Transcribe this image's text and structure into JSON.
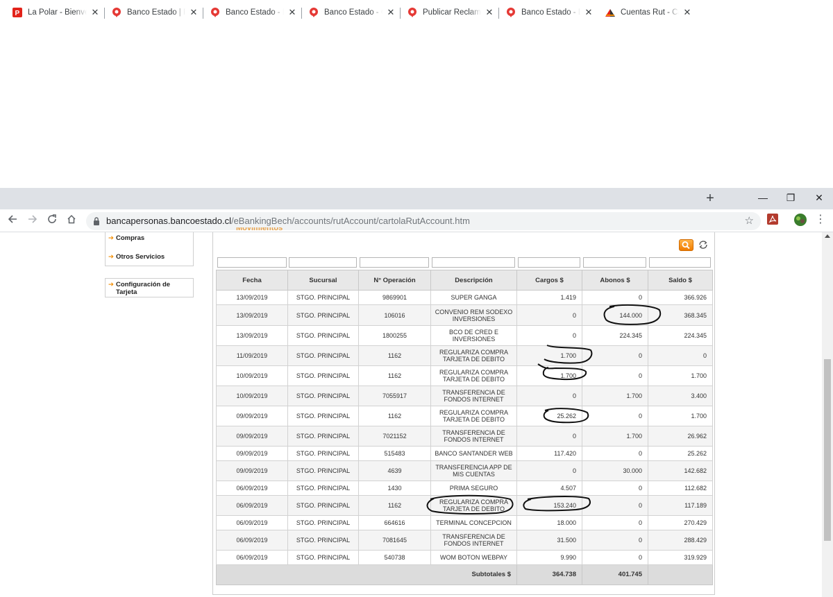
{
  "browser": {
    "tabs": [
      {
        "title": "La Polar - Bienvenido",
        "favicon": "la-polar-icon",
        "active": false
      },
      {
        "title": "Banco Estado | Reclamos",
        "favicon": "reclamos-icon",
        "active": false
      },
      {
        "title": "Banco Estado - Detalle",
        "favicon": "reclamos-icon",
        "active": false
      },
      {
        "title": "Banco Estado - Comentarios",
        "favicon": "reclamos-icon",
        "active": false
      },
      {
        "title": "Publicar Reclamo | Reclamos",
        "favicon": "reclamos-icon",
        "active": false
      },
      {
        "title": "Banco Estado - Duplicado",
        "favicon": "reclamos-icon",
        "active": false
      },
      {
        "title": "Cuentas Rut - Cartola",
        "favicon": "banco-estado-icon",
        "active": true
      }
    ],
    "new_tab": "+",
    "window_controls": {
      "minimize": "—",
      "restore": "❐",
      "close": "✕"
    },
    "url_domain": "bancapersonas.bancoestado.cl",
    "url_path": "/eBankingBech/accounts/rutAccount/cartolaRutAccount.htm",
    "colors": {
      "tabstrip": "#dee1e6",
      "accent_orange": "#f28c00"
    }
  },
  "sidebar": {
    "items": [
      {
        "label": "Compras"
      },
      {
        "label": "Otros Servicios"
      },
      {
        "label": "Configuración de Tarjeta"
      }
    ]
  },
  "section": {
    "title": "Movimientos"
  },
  "table": {
    "columns": [
      "Fecha",
      "Sucursal",
      "N° Operación",
      "Descripción",
      "Cargos $",
      "Abonos $",
      "Saldo $"
    ],
    "rows": [
      {
        "fecha": "13/09/2019",
        "sucursal": "STGO. PRINCIPAL",
        "operacion": "9869901",
        "descripcion": "SUPER GANGA",
        "cargos": "1.419",
        "abonos": "0",
        "saldo": "366.926"
      },
      {
        "fecha": "13/09/2019",
        "sucursal": "STGO. PRINCIPAL",
        "operacion": "106016",
        "descripcion": "CONVENIO REM SODEXO INVERSIONES",
        "cargos": "0",
        "abonos": "144.000",
        "saldo": "368.345"
      },
      {
        "fecha": "13/09/2019",
        "sucursal": "STGO. PRINCIPAL",
        "operacion": "1800255",
        "descripcion": "BCO DE CRED E INVERSIONES",
        "cargos": "0",
        "abonos": "224.345",
        "saldo": "224.345"
      },
      {
        "fecha": "11/09/2019",
        "sucursal": "STGO. PRINCIPAL",
        "operacion": "1162",
        "descripcion": "REGULARIZA COMPRA TARJETA DE DEBITO",
        "cargos": "1.700",
        "abonos": "0",
        "saldo": "0"
      },
      {
        "fecha": "10/09/2019",
        "sucursal": "STGO. PRINCIPAL",
        "operacion": "1162",
        "descripcion": "REGULARIZA COMPRA TARJETA DE DEBITO",
        "cargos": "1.700",
        "abonos": "0",
        "saldo": "1.700"
      },
      {
        "fecha": "10/09/2019",
        "sucursal": "STGO. PRINCIPAL",
        "operacion": "7055917",
        "descripcion": "TRANSFERENCIA DE FONDOS INTERNET",
        "cargos": "0",
        "abonos": "1.700",
        "saldo": "3.400"
      },
      {
        "fecha": "09/09/2019",
        "sucursal": "STGO. PRINCIPAL",
        "operacion": "1162",
        "descripcion": "REGULARIZA COMPRA TARJETA DE DEBITO",
        "cargos": "25.262",
        "abonos": "0",
        "saldo": "1.700"
      },
      {
        "fecha": "09/09/2019",
        "sucursal": "STGO. PRINCIPAL",
        "operacion": "7021152",
        "descripcion": "TRANSFERENCIA DE FONDOS INTERNET",
        "cargos": "0",
        "abonos": "1.700",
        "saldo": "26.962"
      },
      {
        "fecha": "09/09/2019",
        "sucursal": "STGO. PRINCIPAL",
        "operacion": "515483",
        "descripcion": "BANCO SANTANDER WEB",
        "cargos": "117.420",
        "abonos": "0",
        "saldo": "25.262"
      },
      {
        "fecha": "09/09/2019",
        "sucursal": "STGO. PRINCIPAL",
        "operacion": "4639",
        "descripcion": "TRANSFERENCIA APP DE MIS CUENTAS",
        "cargos": "0",
        "abonos": "30.000",
        "saldo": "142.682"
      },
      {
        "fecha": "06/09/2019",
        "sucursal": "STGO. PRINCIPAL",
        "operacion": "1430",
        "descripcion": "PRIMA SEGURO",
        "cargos": "4.507",
        "abonos": "0",
        "saldo": "112.682"
      },
      {
        "fecha": "06/09/2019",
        "sucursal": "STGO. PRINCIPAL",
        "operacion": "1162",
        "descripcion": "REGULARIZA COMPRA TARJETA DE DEBITO",
        "cargos": "153.240",
        "abonos": "0",
        "saldo": "117.189"
      },
      {
        "fecha": "06/09/2019",
        "sucursal": "STGO. PRINCIPAL",
        "operacion": "664616",
        "descripcion": "TERMINAL CONCEPCION",
        "cargos": "18.000",
        "abonos": "0",
        "saldo": "270.429"
      },
      {
        "fecha": "06/09/2019",
        "sucursal": "STGO. PRINCIPAL",
        "operacion": "7081645",
        "descripcion": "TRANSFERENCIA DE FONDOS INTERNET",
        "cargos": "31.500",
        "abonos": "0",
        "saldo": "288.429"
      },
      {
        "fecha": "06/09/2019",
        "sucursal": "STGO. PRINCIPAL",
        "operacion": "540738",
        "descripcion": "WOM BOTON WEBPAY",
        "cargos": "9.990",
        "abonos": "0",
        "saldo": "319.929"
      }
    ],
    "subtotals": {
      "label": "Subtotales $",
      "cargos": "364.738",
      "abonos": "401.745"
    }
  }
}
